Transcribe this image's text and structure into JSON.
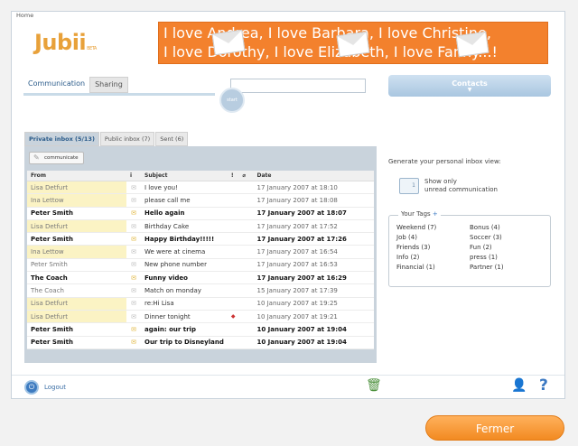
{
  "breadcrumb": "Home",
  "logo": {
    "name": "Jubii",
    "badge": "BETA"
  },
  "banner": {
    "line1": "I love Andrea, I love Barbara, I love Christine,",
    "line2": "I love Dorothy, I love Elizabeth, I love Fanny...!"
  },
  "top_tabs": [
    {
      "label": "Communication"
    },
    {
      "label": "Sharing"
    }
  ],
  "search": {
    "placeholder": "",
    "button_label": "start"
  },
  "contacts_label": "Contacts",
  "inbox_tabs": [
    {
      "label": "Private inbox (5/13)"
    },
    {
      "label": "Public inbox (7)"
    },
    {
      "label": "Sent (6)"
    }
  ],
  "communicate_label": "communicate",
  "table": {
    "headers": {
      "from": "From",
      "icon": "i",
      "subject": "Subject",
      "flag": "!",
      "attach": "",
      "date": "Date"
    },
    "rows": [
      {
        "from": "Lisa Detfurt",
        "subject": "I love you!",
        "date": "17 January 2007 at 18:10",
        "unread": false,
        "highlight": true,
        "flag": ""
      },
      {
        "from": "Ina Lettow",
        "subject": "please call me",
        "date": "17 January 2007 at 18:08",
        "unread": false,
        "highlight": true,
        "flag": ""
      },
      {
        "from": "Peter Smith",
        "subject": "Hello again",
        "date": "17 January 2007 at 18:07",
        "unread": true,
        "highlight": false,
        "flag": ""
      },
      {
        "from": "Lisa Detfurt",
        "subject": "Birthday Cake",
        "date": "17 January 2007 at 17:52",
        "unread": false,
        "highlight": true,
        "flag": ""
      },
      {
        "from": "Peter Smith",
        "subject": "Happy Birthday!!!!!",
        "date": "17 January 2007 at 17:26",
        "unread": true,
        "highlight": false,
        "flag": ""
      },
      {
        "from": "Ina Lettow",
        "subject": "We were at cinema",
        "date": "17 January 2007 at 16:54",
        "unread": false,
        "highlight": true,
        "flag": ""
      },
      {
        "from": "Peter Smith",
        "subject": "New phone number",
        "date": "17 January 2007 at 16:53",
        "unread": false,
        "highlight": false,
        "flag": ""
      },
      {
        "from": "The Coach",
        "subject": "Funny video",
        "date": "17 January 2007 at 16:29",
        "unread": true,
        "highlight": false,
        "flag": ""
      },
      {
        "from": "The Coach",
        "subject": "Match on monday",
        "date": "15 January 2007 at 17:39",
        "unread": false,
        "highlight": false,
        "flag": ""
      },
      {
        "from": "Lisa Detfurt",
        "subject": "re:Hi Lisa",
        "date": "10 January 2007 at 19:25",
        "unread": false,
        "highlight": true,
        "flag": ""
      },
      {
        "from": "Lisa Detfurt",
        "subject": "Dinner tonight",
        "date": "10 January 2007 at 19:21",
        "unread": false,
        "highlight": true,
        "flag": "◆"
      },
      {
        "from": "Peter Smith",
        "subject": "again: our trip",
        "date": "10 January 2007 at 19:04",
        "unread": true,
        "highlight": false,
        "flag": ""
      },
      {
        "from": "Peter Smith",
        "subject": "Our trip to Disneyland",
        "date": "10 January 2007 at 19:04",
        "unread": true,
        "highlight": false,
        "flag": ""
      }
    ]
  },
  "side": {
    "generate_label": "Generate your personal inbox view:",
    "unread_line1": "Show only",
    "unread_line2": "unread communication",
    "tags_title": "Your Tags",
    "tags_plus": "+",
    "tags": [
      "Weekend (7)",
      "Bonus (4)",
      "Job (4)",
      "Soccer (3)",
      "Friends (3)",
      "Fun (2)",
      "Info (2)",
      "press (1)",
      "Financial (1)",
      "Partner (1)"
    ]
  },
  "footer": {
    "logout_label": "Logout"
  },
  "close_button": "Fermer"
}
